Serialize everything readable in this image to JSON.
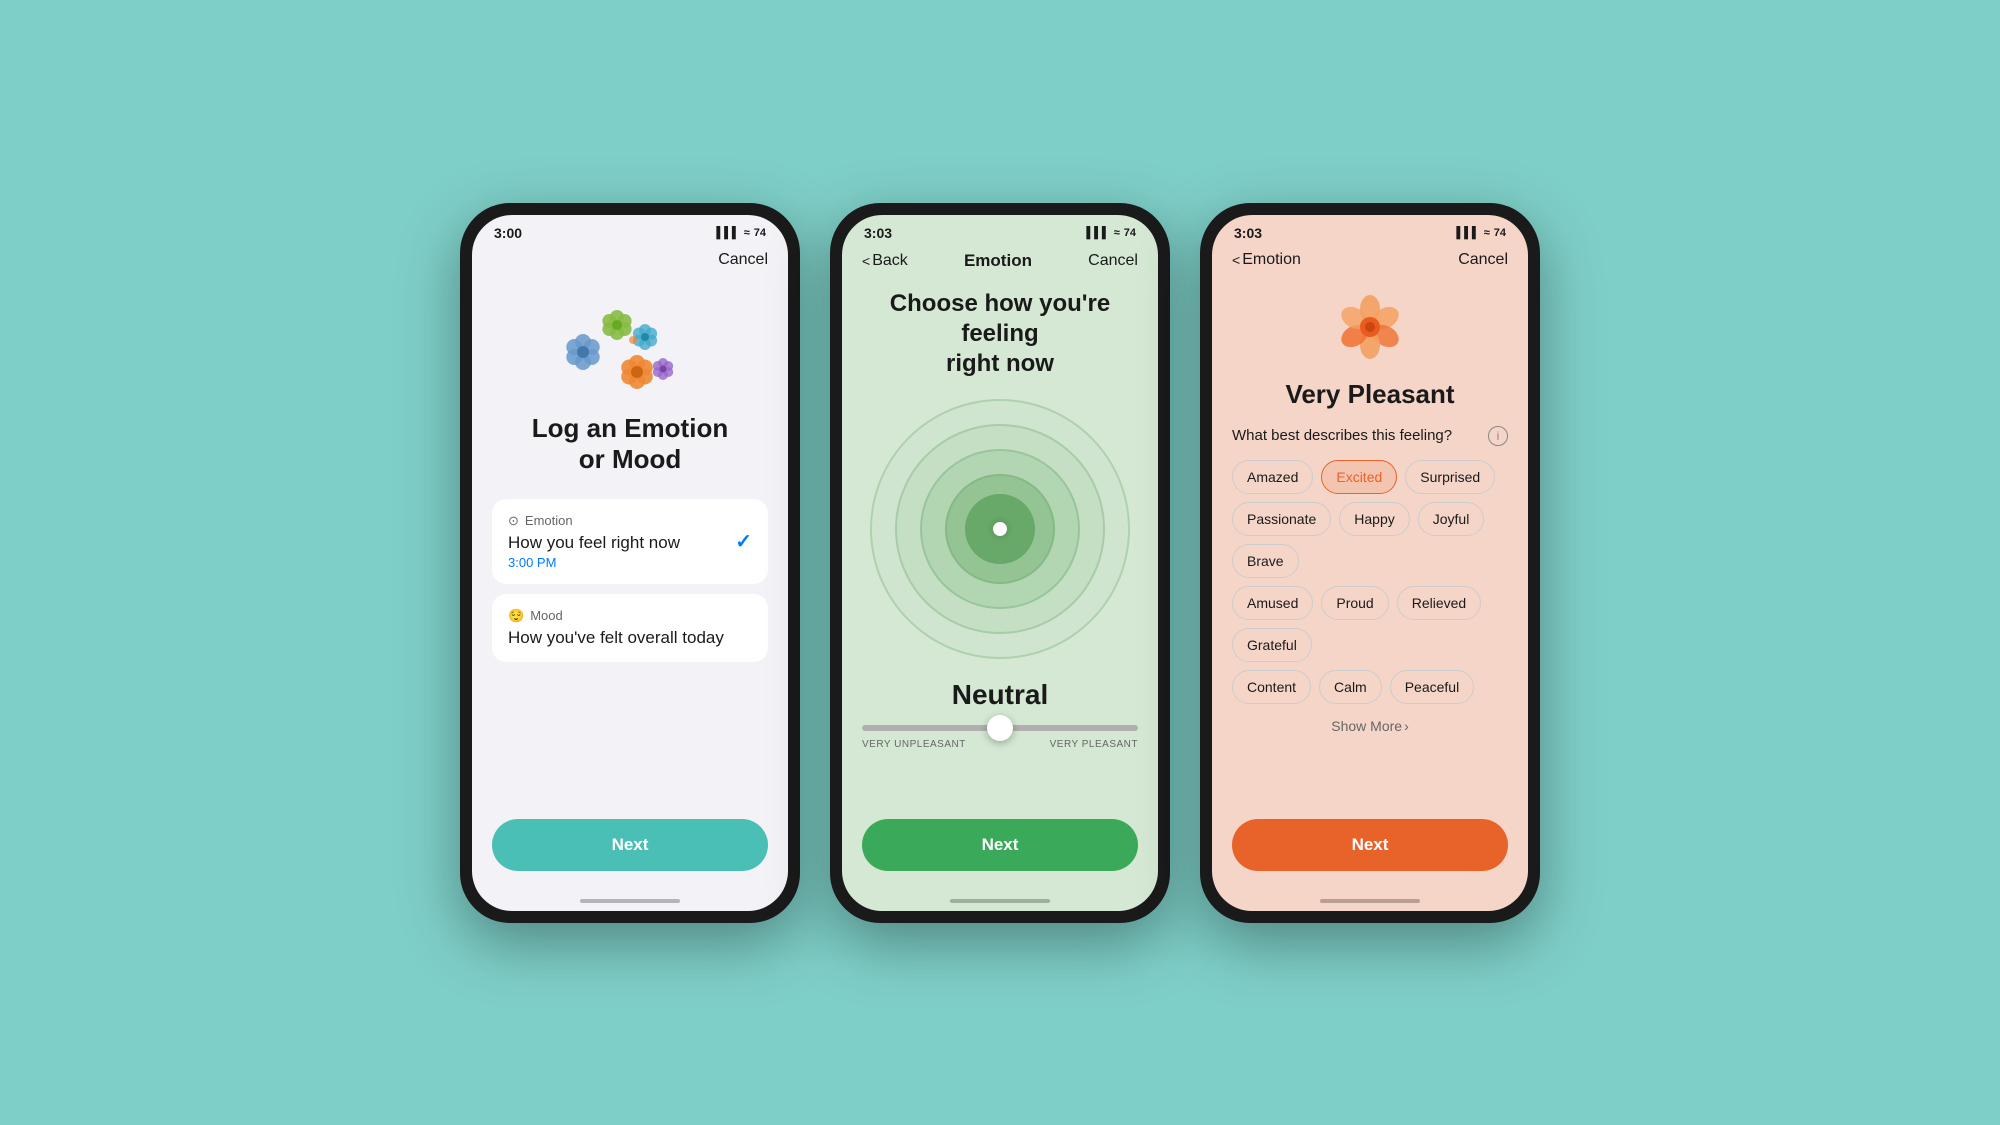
{
  "background_color": "#7ecfc8",
  "phones": [
    {
      "id": "phone1",
      "status_bar": {
        "time": "3:00",
        "time_arrow": "▶",
        "signal": "▌▌▌",
        "wifi": "wifi",
        "battery": "74"
      },
      "nav": {
        "cancel_label": "Cancel"
      },
      "screen": {
        "title": "Log an Emotion\nor Mood",
        "option1": {
          "icon": "●",
          "label": "Emotion",
          "description": "How you feel right now",
          "time": "3:00 PM",
          "selected": true
        },
        "option2": {
          "icon": "😌",
          "label": "Mood",
          "description": "How you've felt overall today"
        },
        "next_label": "Next",
        "next_color": "#4abfb5"
      }
    },
    {
      "id": "phone2",
      "status_bar": {
        "time": "3:03",
        "time_arrow": "▶",
        "signal": "▌▌▌",
        "wifi": "wifi",
        "battery": "74"
      },
      "nav": {
        "back_label": "Back",
        "title": "Emotion",
        "cancel_label": "Cancel"
      },
      "screen": {
        "title": "Choose how you're feeling\nright now",
        "emotion_label": "Neutral",
        "slider_left": "VERY UNPLEASANT",
        "slider_right": "VERY PLEASANT",
        "next_label": "Next",
        "next_color": "#3aaa5a"
      }
    },
    {
      "id": "phone3",
      "status_bar": {
        "time": "3:03",
        "time_arrow": "▶",
        "signal": "▌▌▌",
        "wifi": "wifi",
        "battery": "74"
      },
      "nav": {
        "back_label": "Emotion",
        "cancel_label": "Cancel"
      },
      "screen": {
        "feeling_level": "Very Pleasant",
        "describe_question": "What best describes this feeling?",
        "tags": [
          {
            "label": "Amazed",
            "selected": false
          },
          {
            "label": "Excited",
            "selected": true
          },
          {
            "label": "Surprised",
            "selected": false
          },
          {
            "label": "Passionate",
            "selected": false
          },
          {
            "label": "Happy",
            "selected": false
          },
          {
            "label": "Joyful",
            "selected": false
          },
          {
            "label": "Brave",
            "selected": false
          },
          {
            "label": "Amused",
            "selected": false
          },
          {
            "label": "Proud",
            "selected": false
          },
          {
            "label": "Relieved",
            "selected": false
          },
          {
            "label": "Grateful",
            "selected": false
          },
          {
            "label": "Content",
            "selected": false
          },
          {
            "label": "Calm",
            "selected": false
          },
          {
            "label": "Peaceful",
            "selected": false
          }
        ],
        "show_more_label": "Show More",
        "next_label": "Next",
        "next_color": "#e8632a"
      }
    }
  ]
}
